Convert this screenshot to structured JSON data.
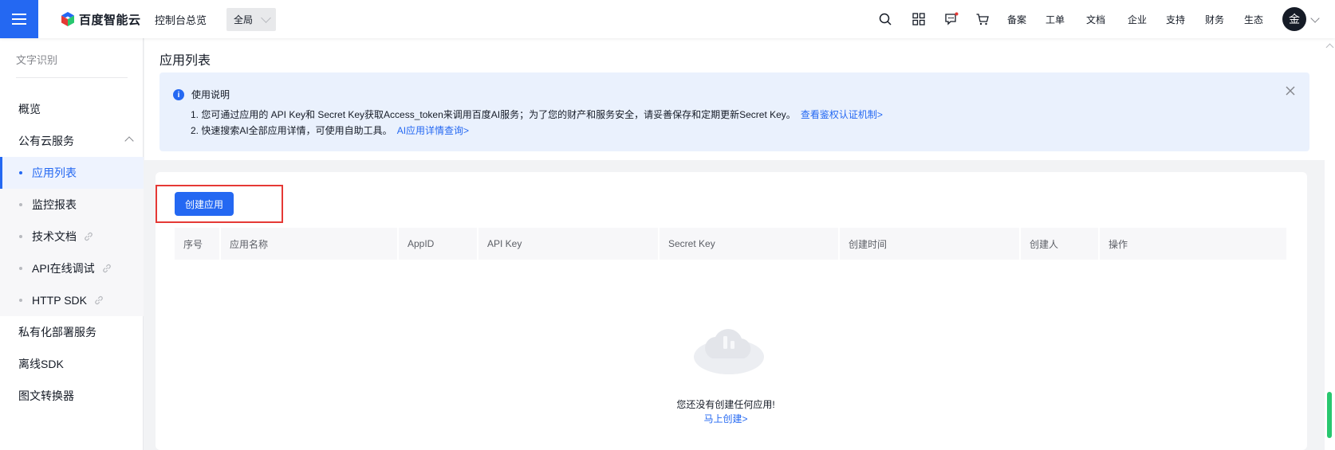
{
  "topbar": {
    "brand": "百度智能云",
    "overview": "控制台总览",
    "region": "全局",
    "links": [
      "备案",
      "工单",
      "文档",
      "企业",
      "支持",
      "财务",
      "生态"
    ],
    "avatar_initial": "金",
    "icons": [
      "search-icon",
      "apps-icon",
      "message-icon",
      "cart-icon"
    ],
    "accent": "#2468f2"
  },
  "sidebar": {
    "title": "文字识别",
    "items": {
      "overview": "概览",
      "public_cloud": "公有云服务",
      "private_deploy": "私有化部署服务",
      "offline_sdk": "离线SDK",
      "converter": "图文转换器"
    },
    "sub_items": [
      "应用列表",
      "监控报表",
      "技术文档",
      "API在线调试",
      "HTTP SDK"
    ]
  },
  "page": {
    "title": "应用列表",
    "notice": {
      "title": "使用说明",
      "line1": "1. 您可通过应用的 API Key和 Secret Key获取Access_token来调用百度AI服务；为了您的财产和服务安全，请妥善保存和定期更新Secret Key。",
      "line1_link": "查看鉴权认证机制>",
      "line2": "2. 快速搜索AI全部应用详情，可使用自助工具。",
      "line2_link": "AI应用详情查询>"
    },
    "create_button": "创建应用",
    "table_headers": [
      "序号",
      "应用名称",
      "AppID",
      "API Key",
      "Secret Key",
      "创建时间",
      "创建人",
      "操作"
    ],
    "empty_text": "您还没有创建任何应用!",
    "empty_link": "马上创建>"
  }
}
